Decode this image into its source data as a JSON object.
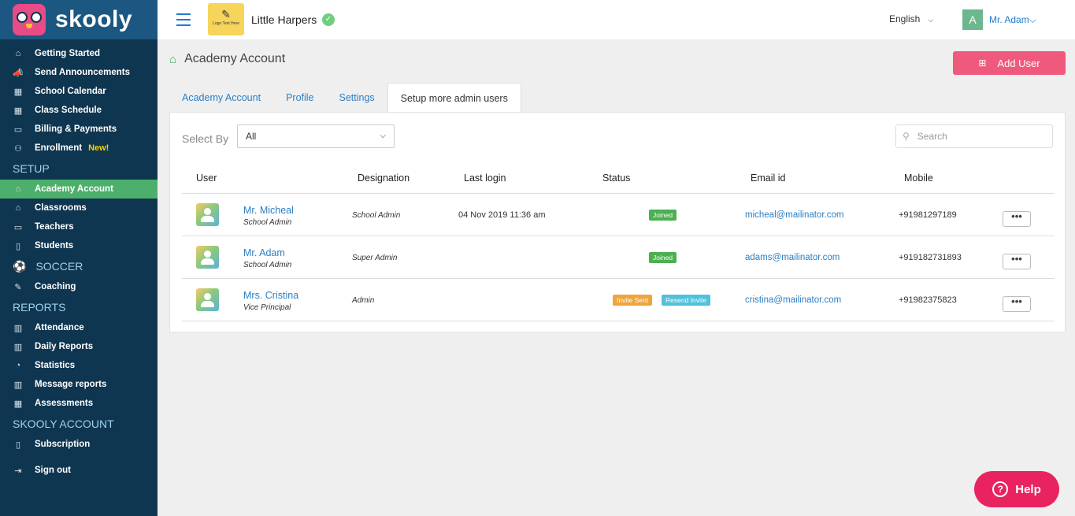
{
  "brand": {
    "name": "skooly"
  },
  "sidebar": {
    "items": [
      {
        "label": "Getting Started",
        "icon": "⌂"
      },
      {
        "label": "Send Announcements",
        "icon": "📣"
      },
      {
        "label": "School Calendar",
        "icon": "▦"
      },
      {
        "label": "Class Schedule",
        "icon": "▦"
      },
      {
        "label": "Billing & Payments",
        "icon": "▭"
      },
      {
        "label": "Enrollment",
        "icon": "⚇",
        "badge": "New!"
      }
    ],
    "setup": {
      "title": "SETUP",
      "items": [
        {
          "label": "Academy Account",
          "icon": "⌂",
          "active": true
        },
        {
          "label": "Classrooms",
          "icon": "⌂"
        },
        {
          "label": "Teachers",
          "icon": "▭"
        },
        {
          "label": "Students",
          "icon": "▯"
        }
      ]
    },
    "soccer": {
      "title": "SOCCER",
      "icon": "⚽",
      "items": [
        {
          "label": "Coaching",
          "icon": "✎"
        }
      ]
    },
    "reports": {
      "title": "REPORTS",
      "items": [
        {
          "label": "Attendance",
          "icon": "▥"
        },
        {
          "label": "Daily Reports",
          "icon": "▥"
        },
        {
          "label": "Statistics",
          "icon": "◔"
        },
        {
          "label": "Message reports",
          "icon": "▥"
        },
        {
          "label": "Assessments",
          "icon": "▦"
        }
      ]
    },
    "account": {
      "title": "SKOOLY ACCOUNT",
      "items": [
        {
          "label": "Subscription",
          "icon": "▯"
        }
      ]
    },
    "signout": {
      "label": "Sign out",
      "icon": "⇥"
    }
  },
  "topbar": {
    "logo_text": "Logo Text Here",
    "school_name": "Little Harpers",
    "language": "English",
    "user_initial": "A",
    "user_name": "Mr. Adam"
  },
  "page": {
    "title": "Academy Account",
    "add_user_label": "Add User",
    "tabs": [
      {
        "label": "Academy Account"
      },
      {
        "label": "Profile"
      },
      {
        "label": "Settings"
      },
      {
        "label": "Setup more admin users",
        "active": true
      }
    ],
    "select_by_label": "Select By",
    "select_value": "All",
    "search_placeholder": "Search"
  },
  "table": {
    "headers": [
      "User",
      "Designation",
      "Last login",
      "Status",
      "Email id",
      "Mobile"
    ],
    "rows": [
      {
        "name": "Mr. Micheal",
        "role": "School Admin",
        "designation": "School Admin",
        "last_login": "04 Nov 2019 11:36 am",
        "status": [
          "Joined"
        ],
        "email": "micheal@mailinator.com",
        "mobile": "+91981297189"
      },
      {
        "name": "Mr. Adam",
        "role": "School Admin",
        "designation": "Super Admin",
        "last_login": "",
        "status": [
          "Joined"
        ],
        "email": "adams@mailinator.com",
        "mobile": "+919182731893"
      },
      {
        "name": "Mrs. Cristina",
        "role": "Vice Principal",
        "designation": "Admin",
        "last_login": "",
        "status": [
          "Invite Sent",
          "Resend Invite"
        ],
        "email": "cristina@mailinator.com",
        "mobile": "+91982375823"
      }
    ]
  },
  "help": {
    "label": "Help"
  },
  "colors": {
    "sidebar": "#0f3650",
    "active": "#4caf6b",
    "accent": "#f0597e",
    "link": "#2b7fc4"
  }
}
